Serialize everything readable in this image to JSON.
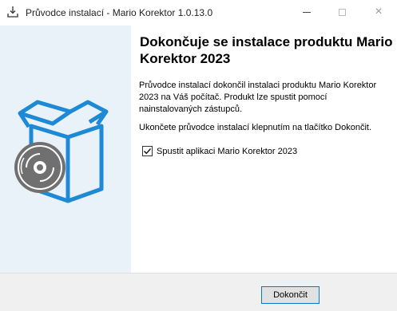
{
  "window": {
    "title": "Průvodce instalací - Mario Korektor 1.0.13.0",
    "icon": "installer-download-icon",
    "controls": {
      "minimize": "minimize-icon",
      "maximize": "maximize-icon",
      "close": "×"
    }
  },
  "banner": {
    "image": "software-box-with-disc-icon",
    "colors": {
      "background": "#e9f1f9",
      "box_stroke": "#1e8ad6",
      "disc_fill": "#707070"
    }
  },
  "content": {
    "heading": "Dokončuje se instalace produktu Mario Korektor 2023",
    "paragraph1": "Průvodce instalací dokončil instalaci produktu Mario Korektor 2023 na Váš počítač. Produkt lze spustit pomocí nainstalovaných zástupců.",
    "paragraph2": "Ukončete průvodce instalací klepnutím na tlačítko Dokončit.",
    "checkbox": {
      "label": "Spustit aplikaci Mario Korektor 2023",
      "checked": true
    }
  },
  "footer": {
    "finish_label": "Dokončit",
    "accent": "#0078d7"
  }
}
